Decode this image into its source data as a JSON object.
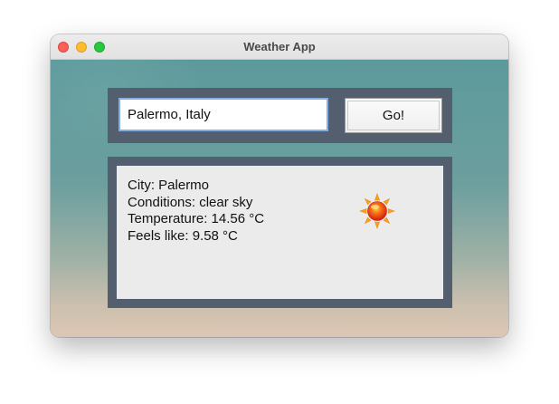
{
  "window": {
    "title": "Weather App"
  },
  "search": {
    "value": "Palermo, Italy",
    "go_label": "Go!"
  },
  "weather": {
    "city_line": "City: Palermo",
    "conditions_line": "Conditions: clear sky",
    "temperature_line": "Temperature: 14.56 °C",
    "feels_like_line": "Feels like: 9.58 °C",
    "icon": "sun-icon"
  },
  "colors": {
    "panel": "#535f6e",
    "input_focus_border": "#84aee6",
    "sun_core": "#e8321a",
    "sun_rays": "#f7a21b"
  }
}
